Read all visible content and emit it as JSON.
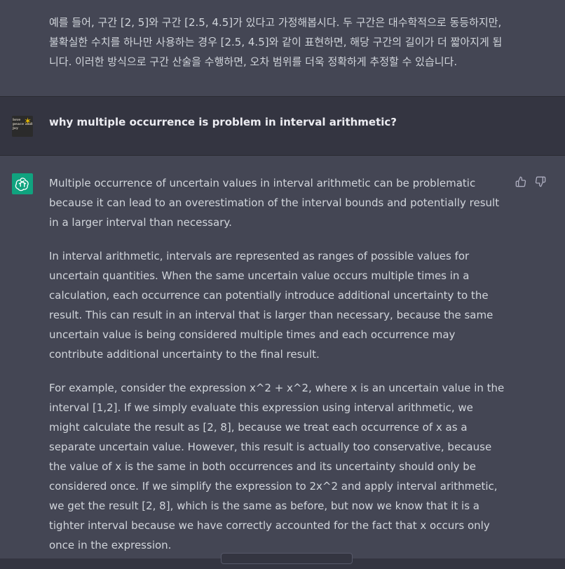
{
  "previous_response": {
    "text": "예를 들어, 구간 [2, 5]와 구간 [2.5, 4.5]가 있다고 가정해봅시다. 두 구간은 대수학적으로 동등하지만, 불확실한 수치를 하나만 사용하는 경우 [2.5, 4.5]와 같이 표현하면, 해당 구간의 길이가 더 짧아지게 됩니다. 이러한 방식으로 구간 산술을 수행하면, 오차 범위를 더욱 정확하게 추정할 수 있습니다."
  },
  "user_message": {
    "avatar_text": "love peace and joy",
    "text": "why multiple occurrence is problem in interval arithmetic?"
  },
  "assistant_message": {
    "paragraphs": [
      "Multiple occurrence of uncertain values in interval arithmetic can be problematic because it can lead to an overestimation of the interval bounds and potentially result in a larger interval than necessary.",
      "In interval arithmetic, intervals are represented as ranges of possible values for uncertain quantities. When the same uncertain value occurs multiple times in a calculation, each occurrence can potentially introduce additional uncertainty to the result. This can result in an interval that is larger than necessary, because the same uncertain value is being considered multiple times and each occurrence may contribute additional uncertainty to the final result.",
      "For example, consider the expression x^2 + x^2, where x is an uncertain value in the interval [1,2]. If we simply evaluate this expression using interval arithmetic, we might calculate the result as [2, 8], because we treat each occurrence of x as a separate uncertain value. However, this result is actually too conservative, because the value of x is the same in both occurrences and its uncertainty should only be considered once. If we simplify the expression to 2x^2 and apply interval arithmetic, we get the result [2, 8], which is the same as before, but now we know that it is a tighter interval because we have correctly accounted for the fact that x occurs only once in the expression."
    ]
  },
  "icons": {
    "assistant_avatar": "openai-logo-icon",
    "thumb_up": "thumbs-up-icon",
    "thumb_down": "thumbs-down-icon"
  },
  "colors": {
    "background": "#343541",
    "assistant_bg": "#444654",
    "gpt_green": "#10a37f",
    "text": "#d1d5db"
  }
}
